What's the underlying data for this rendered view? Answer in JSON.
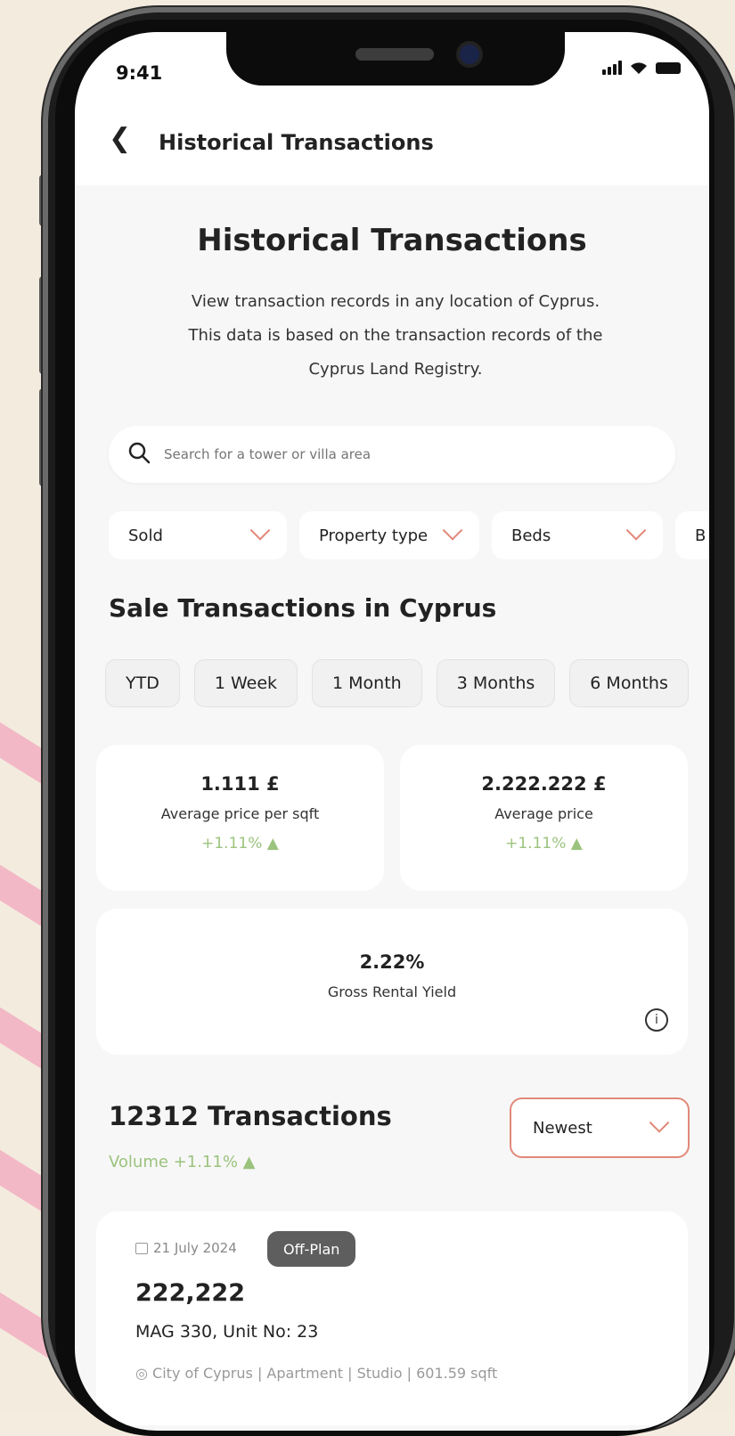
{
  "status_bar": {
    "time": "9:41"
  },
  "nav": {
    "title": "Historical Transactions"
  },
  "hero": {
    "title": "Historical Transactions",
    "description": "View transaction records in any location of Cyprus. This data is based on the transaction records of the Cyprus Land Registry."
  },
  "search": {
    "placeholder": "Search for a tower or villa area"
  },
  "filters": [
    {
      "label": "Sold"
    },
    {
      "label": "Property type"
    },
    {
      "label": "Beds"
    },
    {
      "label": "B"
    }
  ],
  "section_title": "Sale Transactions in Cyprus",
  "periods": [
    "YTD",
    "1 Week",
    "1 Month",
    "3 Months",
    "6 Months"
  ],
  "stats": [
    {
      "value": "1.111 £",
      "label": "Average price per sqft",
      "change": "+1.11% ▲"
    },
    {
      "value": "2.222.222 £",
      "label": "Average price",
      "change": "+1.11% ▲"
    }
  ],
  "yield": {
    "value": "2.22%",
    "label": "Gross Rental Yield",
    "info": "i"
  },
  "transactions": {
    "count": "12312 Transactions",
    "volume": "Volume +1.11% ▲",
    "sort": "Newest"
  },
  "listing": {
    "date": "21 July 2024",
    "badge": "Off-Plan",
    "price": "222,222",
    "unit": "MAG 330, Unit No: 23",
    "meta": "◎ City of Cyprus  |  Apartment  |  Studio  |  601.59 sqft"
  },
  "colors": {
    "accent": "#e2897a",
    "positive": "#9bc37e",
    "badge": "#5e5e5e"
  }
}
